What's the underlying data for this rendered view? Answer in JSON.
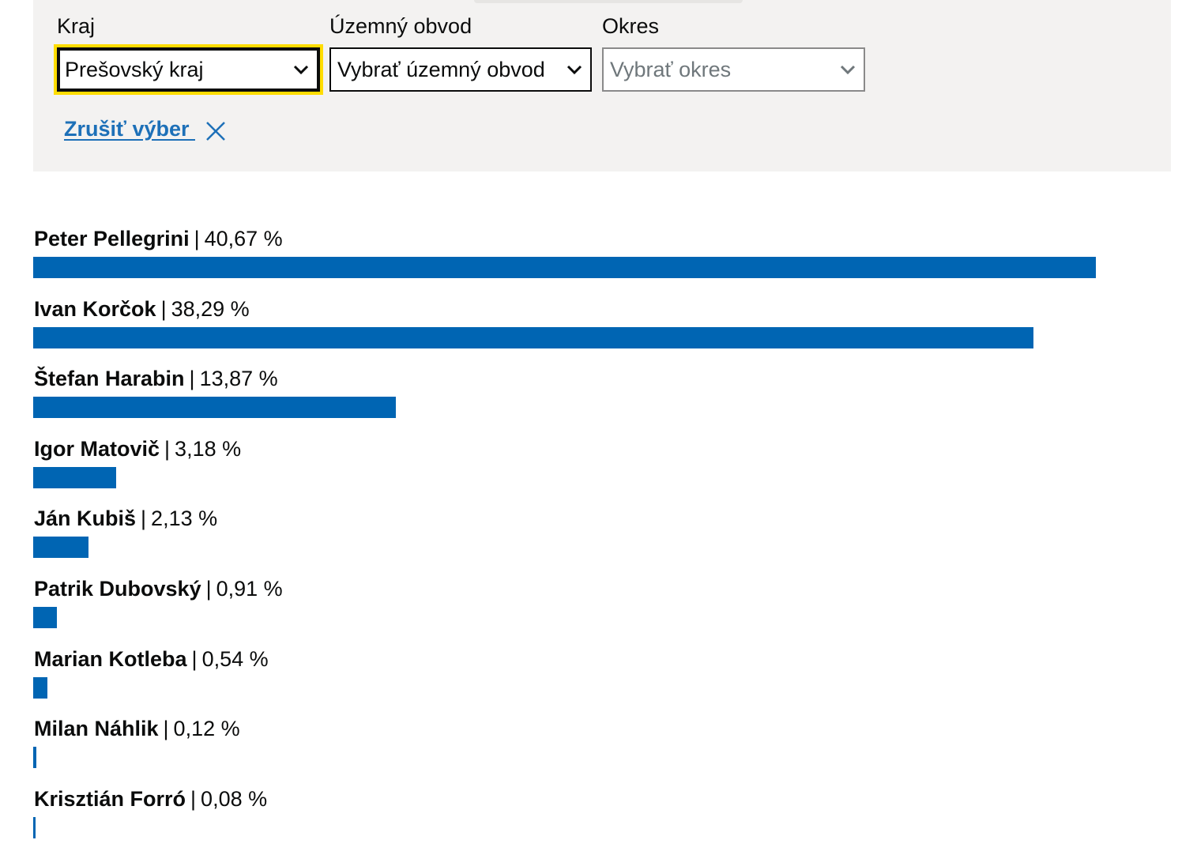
{
  "filters": {
    "kraj": {
      "label": "Kraj",
      "value": "Prešovský kraj"
    },
    "obvod": {
      "label": "Územný obvod",
      "value": "Vybrať územný obvod"
    },
    "okres": {
      "label": "Okres",
      "value": "Vybrať okres"
    },
    "clear_label": "Zrušiť výber "
  },
  "separator": "|",
  "candidates": [
    {
      "name": "Peter Pellegrini",
      "percent_label": "40,67 %",
      "percent": 40.67
    },
    {
      "name": "Ivan Korčok",
      "percent_label": "38,29 %",
      "percent": 38.29
    },
    {
      "name": "Štefan Harabin",
      "percent_label": "13,87 %",
      "percent": 13.87
    },
    {
      "name": "Igor Matovič",
      "percent_label": "3,18 %",
      "percent": 3.18
    },
    {
      "name": "Ján Kubiš",
      "percent_label": "2,13 %",
      "percent": 2.13
    },
    {
      "name": "Patrik Dubovský",
      "percent_label": "0,91 %",
      "percent": 0.91
    },
    {
      "name": "Marian Kotleba",
      "percent_label": "0,54 %",
      "percent": 0.54
    },
    {
      "name": "Milan Náhlik",
      "percent_label": "0,12 %",
      "percent": 0.12
    },
    {
      "name": "Krisztián Forró",
      "percent_label": "0,08 %",
      "percent": 0.08
    }
  ],
  "colors": {
    "bar": "#0065b3",
    "focus": "#ffdd00",
    "link": "#1d70b8",
    "panel": "#f3f2f1"
  }
}
